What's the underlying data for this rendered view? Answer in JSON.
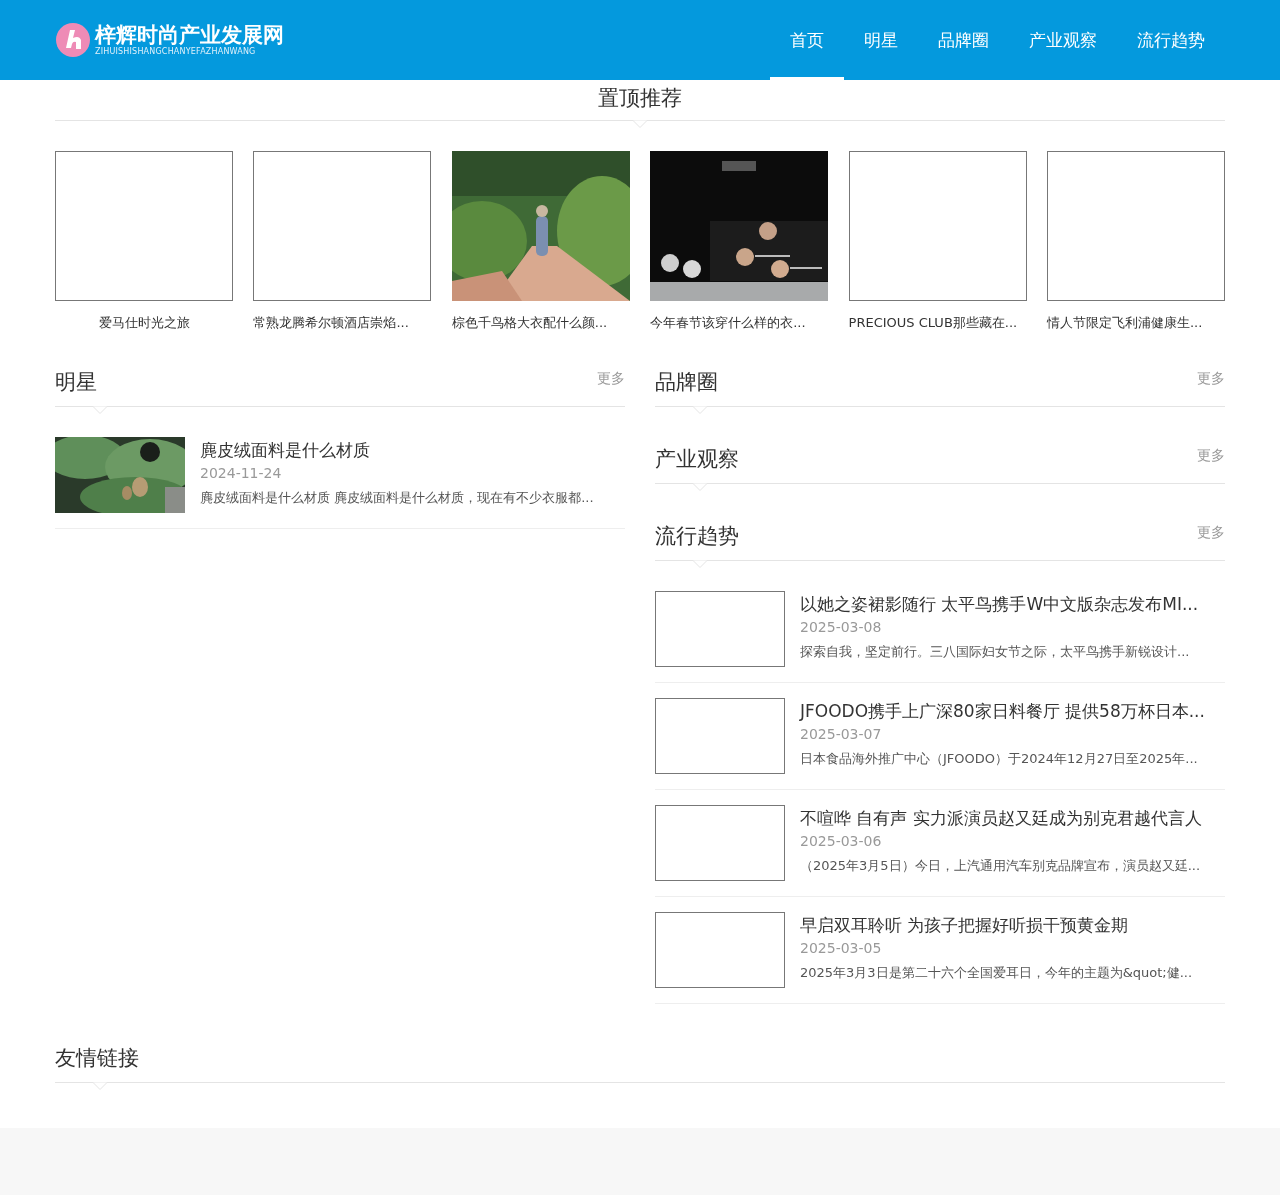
{
  "header": {
    "logo": {
      "title": "梓辉时尚产业发展网",
      "subtitle": "ZIHUISHISHANGCHANYEFAZHANWANG"
    },
    "nav": [
      {
        "label": "首页",
        "selected": true
      },
      {
        "label": "明星",
        "selected": false
      },
      {
        "label": "品牌圈",
        "selected": false
      },
      {
        "label": "产业观察",
        "selected": false
      },
      {
        "label": "流行趋势",
        "selected": false
      }
    ]
  },
  "featured": {
    "title": "置顶推荐",
    "items": [
      {
        "kind": "blank",
        "caption": "爱马仕时光之旅"
      },
      {
        "kind": "blank",
        "caption": "常熟龙腾希尔顿酒店崇焰..."
      },
      {
        "kind": "picture",
        "caption": "棕色千鸟格大衣配什么颜..."
      },
      {
        "kind": "picture",
        "caption": "今年春节该穿什么样的衣..."
      },
      {
        "kind": "blank",
        "caption": "PRECIOUS CLUB那些藏在..."
      },
      {
        "kind": "blank",
        "caption": "情人节限定飞利浦健康生..."
      }
    ]
  },
  "columns": [
    {
      "sections": [
        {
          "title": "明星",
          "more": "更多",
          "articles": [
            {
              "kind": "picture",
              "title": "麂皮绒面料是什么材质",
              "date": "2024-11-24",
              "summary": "麂皮绒面料是什么材质 麂皮绒面料是什么材质，现在有不少衣服都..."
            }
          ]
        }
      ]
    },
    {
      "sections": [
        {
          "title": "品牌圈",
          "more": "更多"
        },
        {
          "title": "产业观察",
          "more": "更多"
        },
        {
          "title": "流行趋势",
          "more": "更多",
          "articles": [
            {
              "kind": "blank",
              "title": "以她之姿裙影随行 太平鸟携手W中文版杂志发布MI...",
              "date": "2025-03-08",
              "summary": "探索自我，坚定前行。三八国际妇女节之际，太平鸟携手新锐设计..."
            },
            {
              "kind": "blank",
              "title": "JFOODO携手上广深80家日料餐厅 提供58万杯日本...",
              "date": "2025-03-07",
              "summary": "日本食品海外推广中心（JFOODO）于2024年12月27日至2025年..."
            },
            {
              "kind": "blank",
              "title": "不喧哗 自有声 实力派演员赵又廷成为别克君越代言人",
              "date": "2025-03-06",
              "summary": "（2025年3月5日）今日，上汽通用汽车别克品牌宣布，演员赵又廷..."
            },
            {
              "kind": "blank",
              "title": "早启双耳聆听 为孩子把握好听损干预黄金期",
              "date": "2025-03-05",
              "summary": "2025年3月3日是第二十六个全国爱耳日，今年的主题为&quot;健..."
            }
          ]
        }
      ]
    }
  ],
  "links": {
    "title": "友情链接"
  }
}
